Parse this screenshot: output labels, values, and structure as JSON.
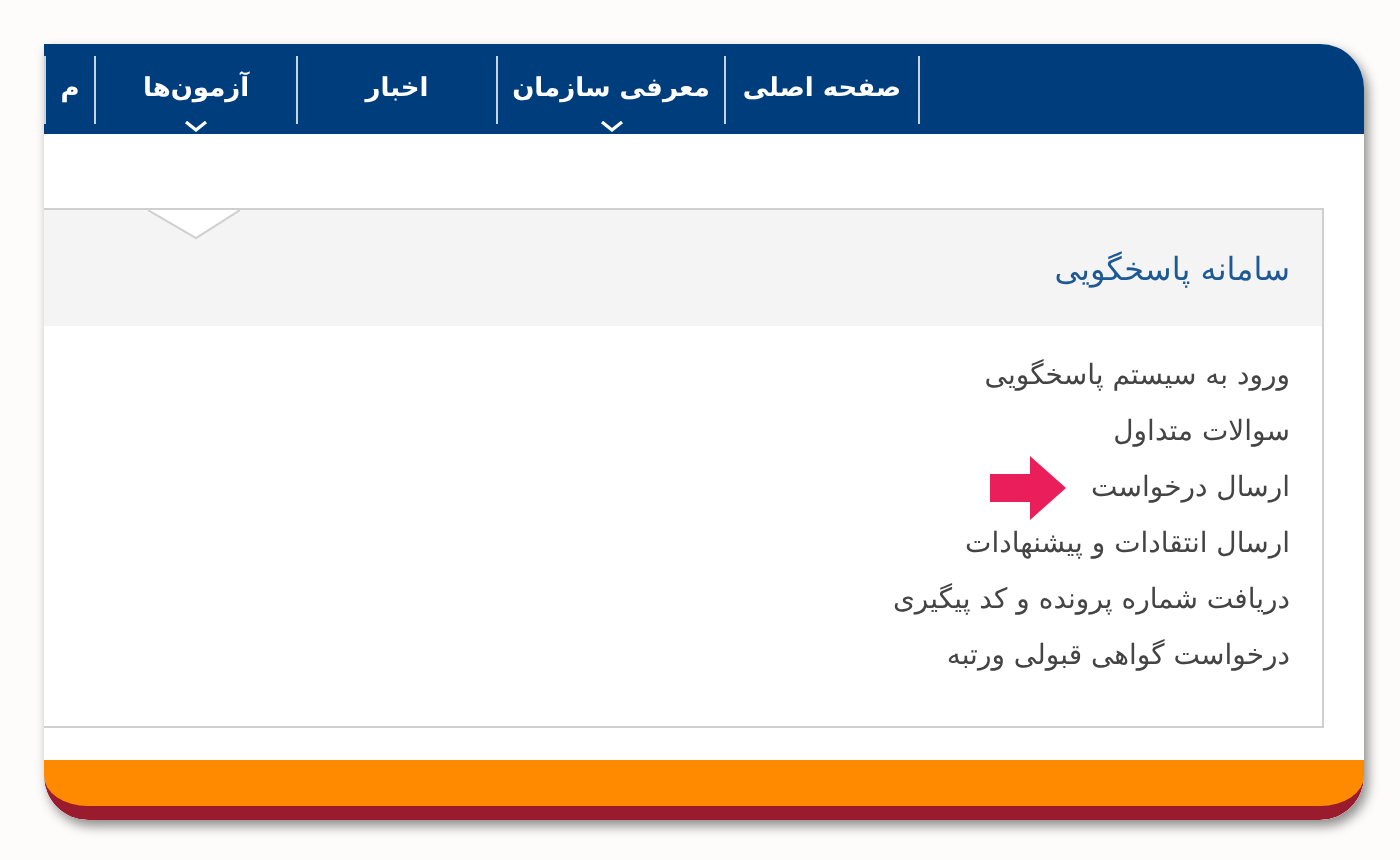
{
  "nav": {
    "items": [
      {
        "label": "صفحه اصلی",
        "has_menu": false
      },
      {
        "label": "معرفی سازمان",
        "has_menu": true
      },
      {
        "label": "اخبار",
        "has_menu": false
      },
      {
        "label": "آزمون‌ها",
        "has_menu": true
      },
      {
        "label": "م",
        "has_menu": false
      }
    ]
  },
  "panel": {
    "title": "سامانه پاسخگویی",
    "links": [
      {
        "label": "ورود به سیستم پاسخگویی",
        "pointed": false
      },
      {
        "label": "سوالات متداول",
        "pointed": false
      },
      {
        "label": "ارسال درخواست",
        "pointed": true
      },
      {
        "label": "ارسال انتقادات و پیشنهادات",
        "pointed": false
      },
      {
        "label": "دریافت شماره پرونده و کد پیگیری",
        "pointed": false
      },
      {
        "label": "درخواست گواهی قبولی ورتبه",
        "pointed": false
      }
    ]
  }
}
